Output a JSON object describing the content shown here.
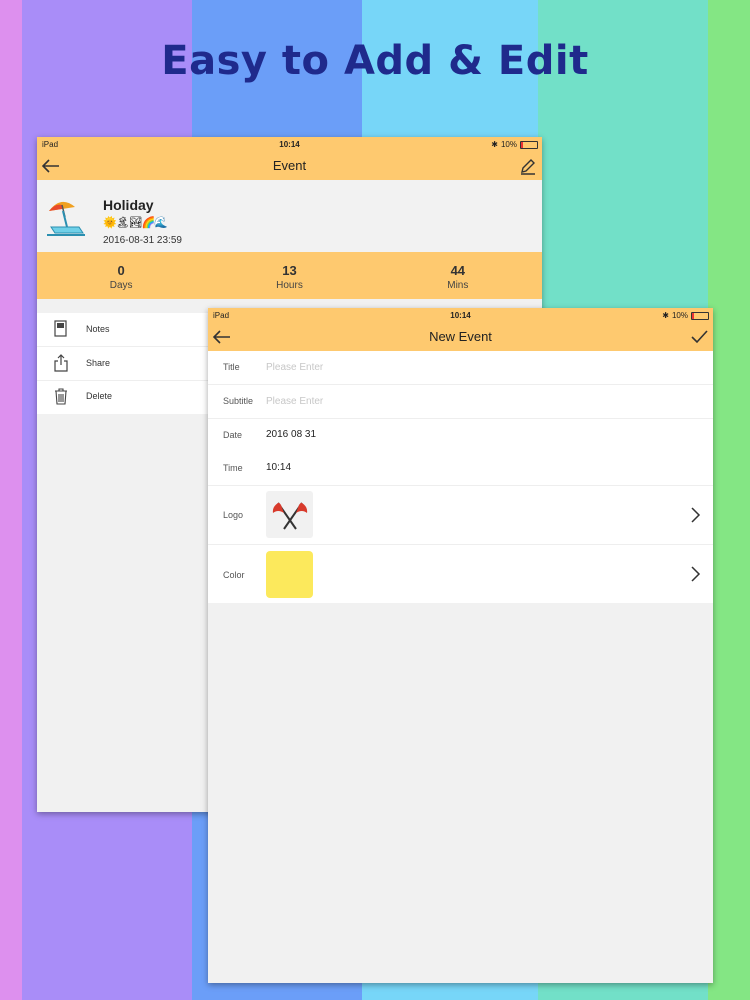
{
  "headline": "Easy to Add & Edit",
  "colors": {
    "stripes": [
      "#dd90ee",
      "#a98df8",
      "#6b9ef8",
      "#77d6f8",
      "#72e0c8",
      "#84e684"
    ],
    "nav_bar": "#fec96f",
    "color_swatch": "#fce95c"
  },
  "event_screen": {
    "status": {
      "carrier": "iPad",
      "time": "10:14",
      "battery": "10%"
    },
    "nav": {
      "title": "Event",
      "back_icon": "back-arrow-icon",
      "edit_icon": "pencil-icon"
    },
    "event": {
      "title": "Holiday",
      "emojis": "🌞🏝🏞🌈🌊",
      "datetime": "2016-08-31 23:59",
      "logo_icon": "beach-umbrella-icon"
    },
    "countdown": [
      {
        "value": "0",
        "unit": "Days"
      },
      {
        "value": "13",
        "unit": "Hours"
      },
      {
        "value": "44",
        "unit": "Mins"
      }
    ],
    "actions": [
      {
        "label": "Notes",
        "icon": "notes-icon"
      },
      {
        "label": "Share",
        "icon": "share-icon"
      },
      {
        "label": "Delete",
        "icon": "trash-icon"
      }
    ]
  },
  "new_event_screen": {
    "status": {
      "carrier": "iPad",
      "time": "10:14",
      "battery": "10%"
    },
    "nav": {
      "title": "New Event",
      "back_icon": "back-arrow-icon",
      "confirm_icon": "checkmark-icon"
    },
    "fields": {
      "title": {
        "label": "Title",
        "placeholder": "Please Enter"
      },
      "subtitle": {
        "label": "Subtitle",
        "placeholder": "Please Enter"
      },
      "date": {
        "label": "Date",
        "value": "2016 08 31"
      },
      "time": {
        "label": "Time",
        "value": "10:14"
      },
      "logo": {
        "label": "Logo",
        "icon": "crossed-flags-icon"
      },
      "color": {
        "label": "Color",
        "value": "#fce95c"
      }
    }
  }
}
